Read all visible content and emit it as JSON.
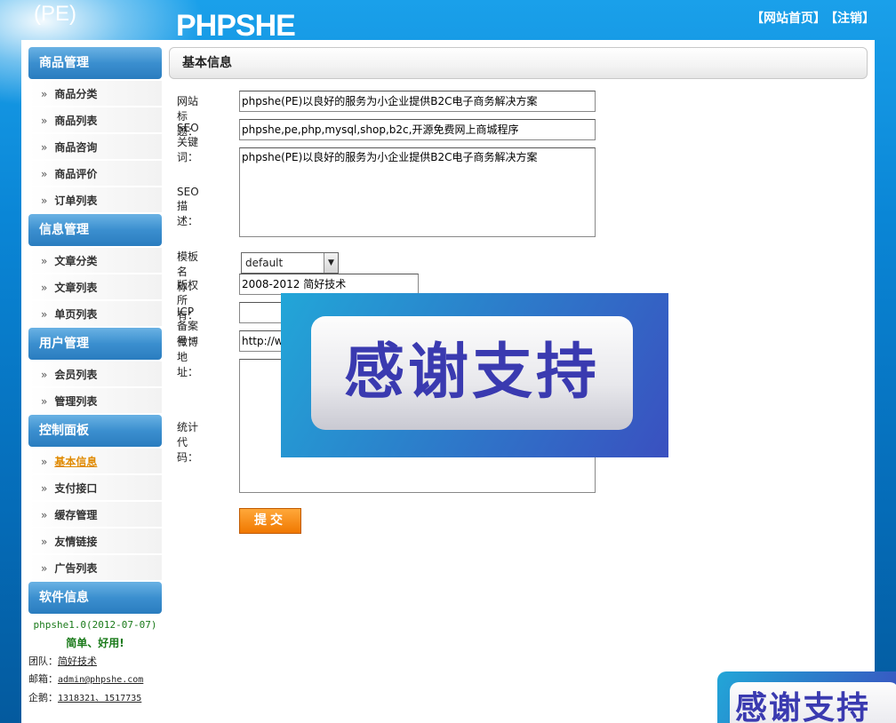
{
  "header": {
    "logo_main": "PHPSHE",
    "logo_sub": "(PE)",
    "links": [
      "【网站首页】",
      "【注销】"
    ]
  },
  "sidebar": {
    "groups": [
      {
        "title": "商品管理",
        "items": [
          "商品分类",
          "商品列表",
          "商品咨询",
          "商品评价",
          "订单列表"
        ]
      },
      {
        "title": "信息管理",
        "items": [
          "文章分类",
          "文章列表",
          "单页列表"
        ]
      },
      {
        "title": "用户管理",
        "items": [
          "会员列表",
          "管理列表"
        ]
      },
      {
        "title": "控制面板",
        "items": [
          "基本信息",
          "支付接口",
          "缓存管理",
          "友情链接",
          "广告列表"
        ]
      },
      {
        "title": "软件信息",
        "items": []
      }
    ],
    "active_item": "基本信息",
    "arrow": "»",
    "software": {
      "version": "phpshe1.0(2012-07-07)",
      "slogan": "简单、好用!",
      "team_label": "团队：",
      "team_value": "简好技术",
      "email_label": "邮箱：",
      "email_value": "admin@phpshe.com",
      "qq_label": "企鹅：",
      "qq_value": "1318321、1517735"
    }
  },
  "main": {
    "title": "基本信息",
    "fields": {
      "site_title_label": "网站标题：",
      "site_title_value": "phpshe(PE)以良好的服务为小企业提供B2C电子商务解决方案",
      "seo_keywords_label": "SEO关键词：",
      "seo_keywords_value": "phpshe,pe,php,mysql,shop,b2c,开源免费网上商城程序",
      "seo_desc_label": "SEO描述：",
      "seo_desc_value": "phpshe(PE)以良好的服务为小企业提供B2C电子商务解决方案",
      "template_label": "模板名称：",
      "template_value": "default",
      "copyright_label": "版权所有：",
      "copyright_value": "2008-2012 简好技术",
      "icp_label": "ICP备案号：",
      "icp_value": "",
      "weibo_label": "微博地址：",
      "weibo_value": "http://we",
      "stats_label": "统计代码：",
      "stats_value": ""
    },
    "submit_label": "提交"
  },
  "overlay": {
    "text": "感谢支持",
    "text_small": "感谢支持"
  }
}
